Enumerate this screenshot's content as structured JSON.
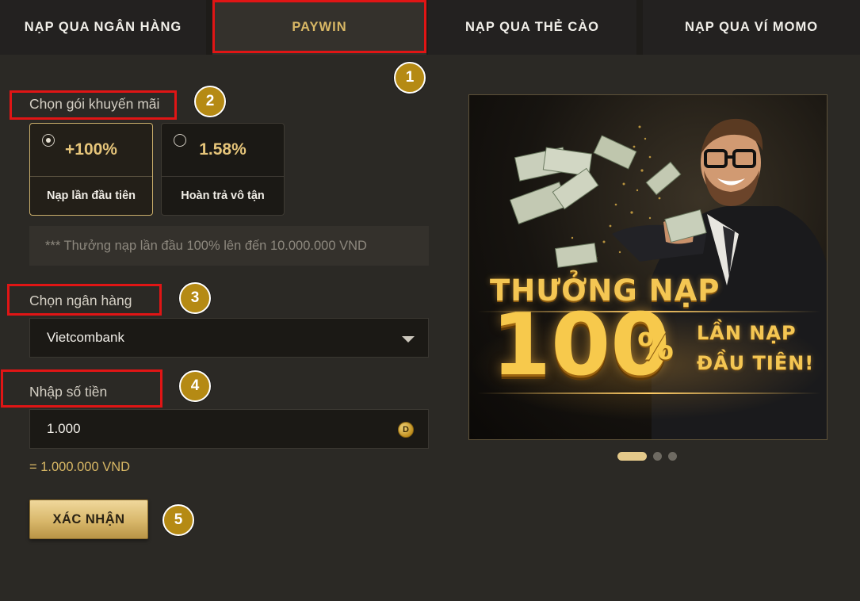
{
  "tabs": [
    {
      "label": "NẠP QUA NGÂN HÀNG",
      "active": false
    },
    {
      "label": "PAYWIN",
      "active": true
    },
    {
      "label": "NẠP QUA THẺ CÀO",
      "active": false
    },
    {
      "label": "NẠP QUA VÍ MOMO",
      "active": false
    }
  ],
  "markers": [
    "1",
    "2",
    "3",
    "4",
    "5"
  ],
  "promo": {
    "label": "Chọn gói khuyến mãi",
    "packages": [
      {
        "value": "+100%",
        "name": "Nạp lần đầu tiên",
        "selected": true
      },
      {
        "value": "1.58%",
        "name": "Hoàn trả vô tận",
        "selected": false
      }
    ],
    "note": "*** Thưởng nạp lần đầu 100% lên đến 10.000.000 VND"
  },
  "bank": {
    "label": "Chọn ngân hàng",
    "selected": "Vietcombank"
  },
  "amount": {
    "label": "Nhập số tiền",
    "value": "1.000",
    "currency_icon": "D",
    "conversion": "= 1.000.000 VND"
  },
  "confirm_label": "XÁC NHẬN",
  "banner": {
    "title": "THƯỞNG NẠP",
    "big": "100",
    "percent": "%",
    "sub1": "LẦN NẠP",
    "sub2": "ĐẦU TIÊN!"
  },
  "carousel": {
    "count": 3,
    "active_index": 0
  },
  "colors": {
    "accent_gold": "#d9b865",
    "highlight_red": "#e01515",
    "marker_gold": "#b58a14",
    "background": "#2b2925"
  }
}
